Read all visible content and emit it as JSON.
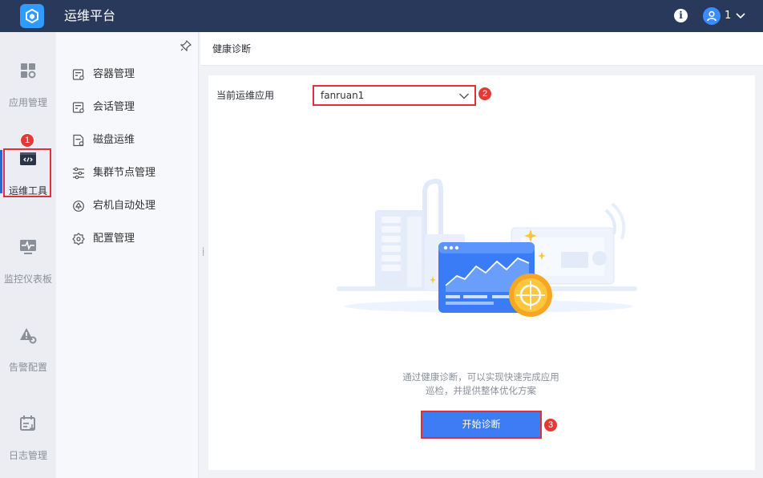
{
  "header": {
    "app_title": "运维平台",
    "info_icon": "info-icon",
    "user_label": "1"
  },
  "rail": {
    "items": [
      {
        "label": "应用管理",
        "icon": "apps-grid-icon",
        "active": false
      },
      {
        "label": "运维工具",
        "icon": "code-window-icon",
        "active": true
      },
      {
        "label": "监控仪表板",
        "icon": "monitor-pulse-icon",
        "active": false
      },
      {
        "label": "告警配置",
        "icon": "warning-gear-icon",
        "active": false
      },
      {
        "label": "日志管理",
        "icon": "calendar-log-icon",
        "active": false
      }
    ]
  },
  "submenu": {
    "items": [
      {
        "label": "容器管理",
        "icon": "container-icon"
      },
      {
        "label": "会话管理",
        "icon": "session-icon"
      },
      {
        "label": "磁盘运维",
        "icon": "disk-icon"
      },
      {
        "label": "集群节点管理",
        "icon": "sliders-icon"
      },
      {
        "label": "宕机自动处理",
        "icon": "auto-recover-icon"
      },
      {
        "label": "配置管理",
        "icon": "config-gear-icon"
      }
    ]
  },
  "main": {
    "page_title": "健康诊断",
    "current_app_label": "当前运维应用",
    "current_app_value": "fanruan1",
    "description_line1": "通过健康诊断，可以实现快速完成应用",
    "description_line2": "巡检，并提供整体优化方案",
    "start_button": "开始诊断"
  },
  "annotations": {
    "badge1": "1",
    "badge2": "2",
    "badge3": "3"
  },
  "colors": {
    "topbar": "#28395c",
    "accent": "#3d7cf5",
    "highlight": "#e0303a",
    "badge": "#e53935"
  }
}
